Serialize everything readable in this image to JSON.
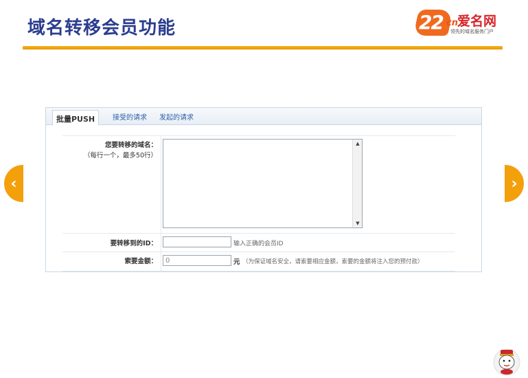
{
  "slide": {
    "title": "域名转移会员功能"
  },
  "logo": {
    "mark": "22",
    "mark_suffix": "cn",
    "name": "爱名网",
    "tagline": "领先的域名服务门户"
  },
  "nav": {
    "prev_glyph": "‹",
    "next_glyph": "›"
  },
  "tabs": [
    {
      "label": "批量PUSH",
      "active": true
    },
    {
      "label": "接受的请求",
      "active": false
    },
    {
      "label": "发起的请求",
      "active": false
    }
  ],
  "form": {
    "domains": {
      "label": "您要转移的域名：",
      "sublabel": "（每行一个，最多50行）",
      "value": ""
    },
    "target_id": {
      "label": "要转移到的ID：",
      "value": "",
      "hint": "输入正确的会员ID"
    },
    "amount": {
      "label": "索要金额：",
      "value": "0",
      "unit": "元",
      "hint": "（为保证域名安全，请索要相应金额，索要的金额将注入您的预付款）"
    }
  },
  "colors": {
    "title": "#2b3d8f",
    "rule": "#f0a30a",
    "arrow": "#f4a00c",
    "link": "#2f5fa8"
  }
}
